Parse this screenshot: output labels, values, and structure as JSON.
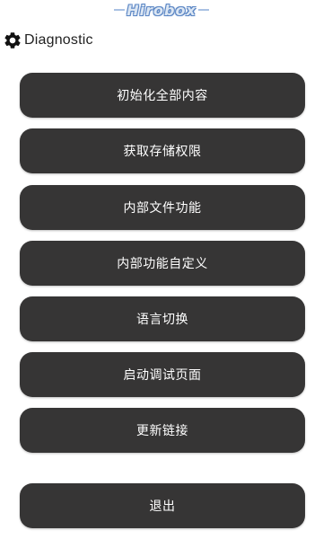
{
  "logo": {
    "text": "Hirobox"
  },
  "header": {
    "icon": "gear-icon",
    "title": "Diagnostic"
  },
  "menu": {
    "items": [
      {
        "label": "初始化全部内容"
      },
      {
        "label": "获取存储权限"
      },
      {
        "label": "内部文件功能"
      },
      {
        "label": "内部功能自定义"
      },
      {
        "label": "语言切换"
      },
      {
        "label": "启动调试页面"
      },
      {
        "label": "更新链接"
      }
    ],
    "exit_label": "退出"
  },
  "colors": {
    "button_bg": "#363535",
    "button_text": "#ffffff",
    "background": "#ffffff",
    "header_text": "#222222",
    "logo_fill": "#dbe6f3",
    "logo_outline": "#5b86c4"
  }
}
